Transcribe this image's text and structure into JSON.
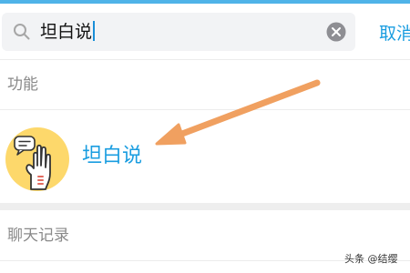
{
  "search": {
    "query": "坦白说",
    "cancel_label": "取消"
  },
  "sections": {
    "function_label": "功能",
    "chat_history_label": "聊天记录"
  },
  "result": {
    "label": "坦白说",
    "icon": "hand-gesture-icon"
  },
  "watermark": "头条 @结缨",
  "colors": {
    "accent": "#1a9de0",
    "arrow": "#f0a060",
    "avatar_bg": "#fdd86b",
    "search_bg": "#f2f3f5"
  }
}
